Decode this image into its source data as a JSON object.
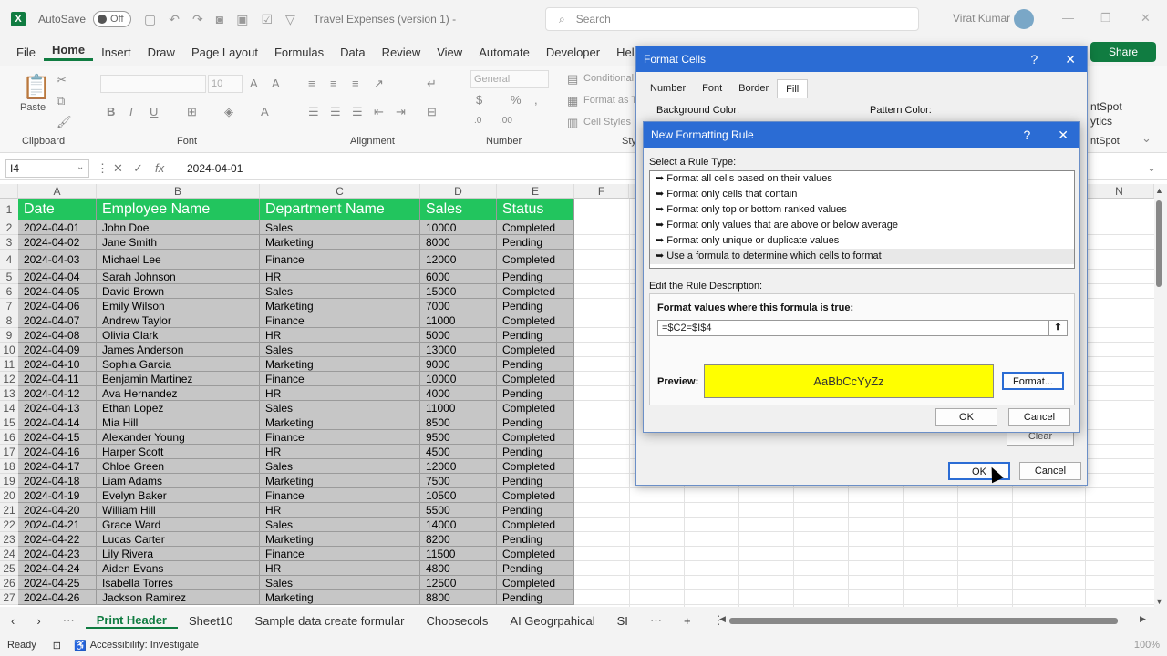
{
  "titlebar": {
    "autosave_label": "AutoSave",
    "autosave_state": "Off",
    "doc_title": "Travel Expenses (version 1)  -",
    "search_placeholder": "Search",
    "user_name": "Virat Kumar"
  },
  "menu": [
    "File",
    "Home",
    "Insert",
    "Draw",
    "Page Layout",
    "Formulas",
    "Data",
    "Review",
    "View",
    "Automate",
    "Developer",
    "Help"
  ],
  "share_label": "Share",
  "ribbon": {
    "paste": "Paste",
    "clipboard": "Clipboard",
    "font": "Font",
    "font_size": "10",
    "alignment": "Alignment",
    "number_format": "General",
    "number": "Number",
    "cond_format": "Conditional",
    "format_as": "Format as T",
    "cell_styles": "Cell Styles",
    "sty": "Sty",
    "hubspot1": "ntSpot",
    "hubspot2": "ytics",
    "hubspot3": "ntSpot"
  },
  "formula_bar": {
    "name_box": "I4",
    "value": "2024-04-01"
  },
  "columns": [
    "A",
    "B",
    "C",
    "D",
    "E",
    "F",
    "N"
  ],
  "header_row": [
    "Date",
    "Employee Name",
    "Department Name",
    "Sales",
    "Status"
  ],
  "rows": [
    [
      "2024-04-01",
      "John Doe",
      "Sales",
      "10000",
      "Completed"
    ],
    [
      "2024-04-02",
      "Jane Smith",
      "Marketing",
      "8000",
      "Pending"
    ],
    [
      "2024-04-03",
      "Michael Lee",
      "Finance",
      "12000",
      "Completed"
    ],
    [
      "2024-04-04",
      "Sarah Johnson",
      "HR",
      "6000",
      "Pending"
    ],
    [
      "2024-04-05",
      "David Brown",
      "Sales",
      "15000",
      "Completed"
    ],
    [
      "2024-04-06",
      "Emily Wilson",
      "Marketing",
      "7000",
      "Pending"
    ],
    [
      "2024-04-07",
      "Andrew Taylor",
      "Finance",
      "11000",
      "Completed"
    ],
    [
      "2024-04-08",
      "Olivia Clark",
      "HR",
      "5000",
      "Pending"
    ],
    [
      "2024-04-09",
      "James Anderson",
      "Sales",
      "13000",
      "Completed"
    ],
    [
      "2024-04-10",
      "Sophia Garcia",
      "Marketing",
      "9000",
      "Pending"
    ],
    [
      "2024-04-11",
      "Benjamin Martinez",
      "Finance",
      "10000",
      "Completed"
    ],
    [
      "2024-04-12",
      "Ava Hernandez",
      "HR",
      "4000",
      "Pending"
    ],
    [
      "2024-04-13",
      "Ethan Lopez",
      "Sales",
      "11000",
      "Completed"
    ],
    [
      "2024-04-14",
      "Mia Hill",
      "Marketing",
      "8500",
      "Pending"
    ],
    [
      "2024-04-15",
      "Alexander Young",
      "Finance",
      "9500",
      "Completed"
    ],
    [
      "2024-04-16",
      "Harper Scott",
      "HR",
      "4500",
      "Pending"
    ],
    [
      "2024-04-17",
      "Chloe Green",
      "Sales",
      "12000",
      "Completed"
    ],
    [
      "2024-04-18",
      "Liam Adams",
      "Marketing",
      "7500",
      "Pending"
    ],
    [
      "2024-04-19",
      "Evelyn Baker",
      "Finance",
      "10500",
      "Completed"
    ],
    [
      "2024-04-20",
      "William Hill",
      "HR",
      "5500",
      "Pending"
    ],
    [
      "2024-04-21",
      "Grace Ward",
      "Sales",
      "14000",
      "Completed"
    ],
    [
      "2024-04-22",
      "Lucas Carter",
      "Marketing",
      "8200",
      "Pending"
    ],
    [
      "2024-04-23",
      "Lily Rivera",
      "Finance",
      "11500",
      "Completed"
    ],
    [
      "2024-04-24",
      "Aiden Evans",
      "HR",
      "4800",
      "Pending"
    ],
    [
      "2024-04-25",
      "Isabella Torres",
      "Sales",
      "12500",
      "Completed"
    ],
    [
      "2024-04-26",
      "Jackson Ramirez",
      "Marketing",
      "8800",
      "Pending"
    ]
  ],
  "sheet_tabs": [
    "Print Header",
    "Sheet10",
    "Sample data create formular",
    "Choosecols",
    "AI Geogrpahical",
    "SI"
  ],
  "status": {
    "ready": "Ready",
    "accessibility": "Accessibility: Investigate",
    "zoom": "100%"
  },
  "format_cells": {
    "title": "Format Cells",
    "tabs": [
      "Number",
      "Font",
      "Border",
      "Fill"
    ],
    "background_color": "Background Color:",
    "pattern_color": "Pattern Color:",
    "clear": "Clear",
    "ok": "OK",
    "cancel": "Cancel"
  },
  "nfr": {
    "title": "New Formatting Rule",
    "select_type": "Select a Rule Type:",
    "rules": [
      "Format all cells based on their values",
      "Format only cells that contain",
      "Format only top or bottom ranked values",
      "Format only values that are above or below average",
      "Format only unique or duplicate values",
      "Use a formula to determine which cells to format"
    ],
    "edit_desc": "Edit the Rule Description:",
    "formula_label": "Format values where this formula is true:",
    "formula": "=$C2=$I$4",
    "preview_label": "Preview:",
    "preview_text": "AaBbCcYyZz",
    "format_btn": "Format...",
    "ok": "OK",
    "cancel": "Cancel"
  },
  "colors": {
    "header_green": "#22c55e",
    "excel_green": "#107c41",
    "preview_yellow": "#ffff00",
    "dialog_blue": "#2b6cd4"
  }
}
